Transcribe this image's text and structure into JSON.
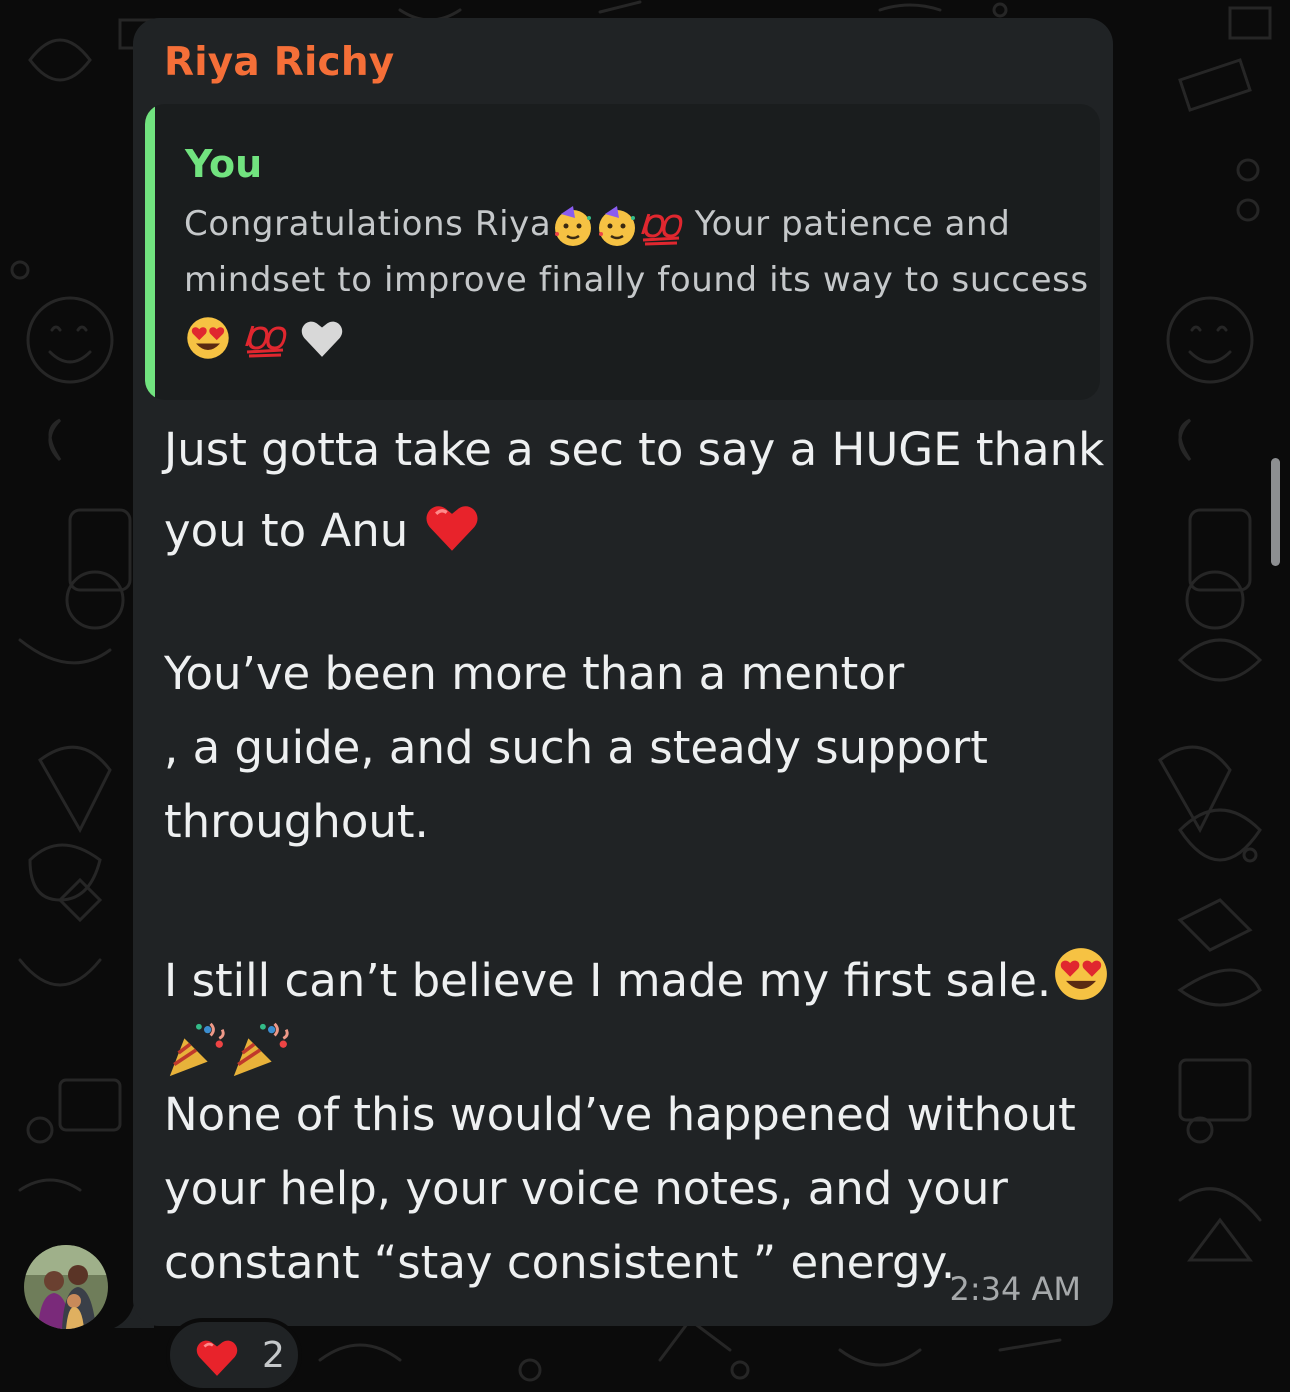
{
  "message": {
    "sender_name": "Riya Richy",
    "quoted": {
      "author": "You",
      "line1_text": "Congratulations Riya",
      "line1_tail": "Your patience and",
      "line2": "mindset to improve finally found its way to success"
    },
    "body": {
      "line1": "Just gotta take a sec to say a HUGE thank",
      "line2": "you to Anu",
      "line3": "You’ve been more than a mentor",
      "line4": ", a guide, and such a steady support",
      "line5": "throughout.",
      "line6": "I still can’t believe I made my first sale.",
      "line7": "None of this would’ve happened without",
      "line8": "your help, your voice notes, and your",
      "line9": "constant “stay consistent ” energy."
    },
    "timestamp": "2:34 AM",
    "reaction": {
      "emoji": "red-heart",
      "count": "2"
    }
  },
  "colors": {
    "sender": "#f56f38",
    "quote_accent": "#71e37f",
    "bubble": "#202325",
    "background": "#0b0b0b"
  }
}
